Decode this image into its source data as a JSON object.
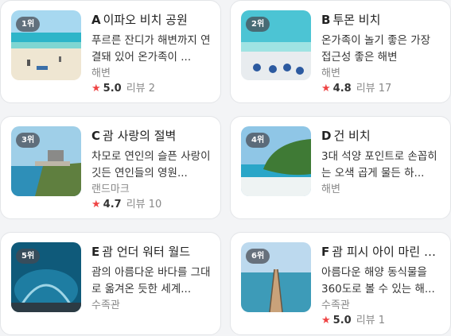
{
  "cards": [
    {
      "rank": "1위",
      "letter": "A",
      "name": "이파오 비치 공원",
      "desc": "푸르른 잔디가 해변까지 연결돼 있어 온가족이 ...",
      "category": "해변",
      "rating": {
        "score": "5.0",
        "reviews_label": "리뷰",
        "reviews": "2"
      },
      "image": "beach-park"
    },
    {
      "rank": "2위",
      "letter": "B",
      "name": "투몬 비치",
      "desc": "온가족이 놀기 좋은 가장 접근성 좋은 해변",
      "category": "해변",
      "rating": {
        "score": "4.8",
        "reviews_label": "리뷰",
        "reviews": "17"
      },
      "image": "tumon-beach"
    },
    {
      "rank": "3위",
      "letter": "C",
      "name": "괌 사랑의 절벽",
      "desc": "차모로 연인의 슬픈 사랑이 깃든 연인들의 영원...",
      "category": "랜드마크",
      "rating": {
        "score": "4.7",
        "reviews_label": "리뷰",
        "reviews": "10"
      },
      "image": "cliff"
    },
    {
      "rank": "4위",
      "letter": "D",
      "name": "건 비치",
      "desc": "3대 석양 포인트로 손꼽히는 오색 곱게 물든 하...",
      "category": "해변",
      "rating": null,
      "image": "gun-beach"
    },
    {
      "rank": "5위",
      "letter": "E",
      "name": "괌 언더 워터 월드",
      "desc": "괌의 아름다운 바다를 그대로 옮겨온 듯한 세계...",
      "category": "수족관",
      "rating": null,
      "image": "aquarium"
    },
    {
      "rank": "6위",
      "letter": "F",
      "name": "괌 피시 아이 마린 파크",
      "desc": "아름다운 해양 동식물을 360도로 볼 수 있는 해...",
      "category": "수족관",
      "rating": {
        "score": "5.0",
        "reviews_label": "리뷰",
        "reviews": "1"
      },
      "image": "pier"
    }
  ],
  "colors": {
    "star": "#ef4444",
    "rank_badge": "#464850"
  }
}
